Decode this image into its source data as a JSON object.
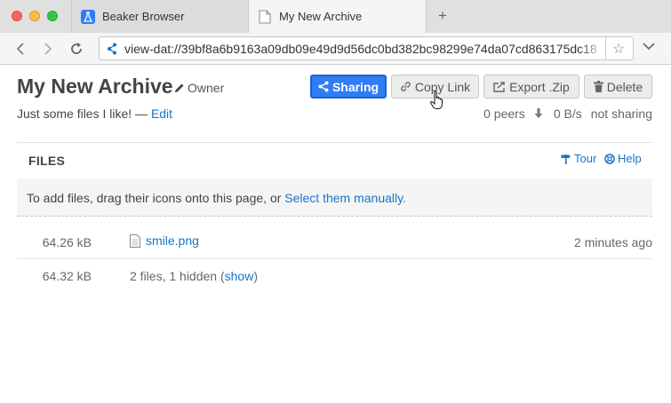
{
  "tabs": [
    {
      "title": "Beaker Browser",
      "icon": "beaker-icon"
    },
    {
      "title": "My New Archive",
      "icon": "page-icon"
    }
  ],
  "new_tab_label": "+",
  "url": "view-dat://39bf8a6b9163a09db09e49d9d56dc0bd382bc98299e74da07cd863175dc18",
  "archive": {
    "title": "My New Archive",
    "owner_label": "Owner",
    "description": "Just some files I like! — ",
    "edit_link": "Edit"
  },
  "buttons": {
    "sharing": "Sharing",
    "copy_link": "Copy Link",
    "export_zip": "Export .Zip",
    "delete": "Delete"
  },
  "stats": {
    "peers": "0 peers",
    "rate": "0 B/s",
    "status": "not sharing"
  },
  "files_section": {
    "title": "FILES",
    "tour": "Tour",
    "help": "Help",
    "drop_text": "To add files, drag their icons onto this page, or ",
    "select_link": "Select them manually."
  },
  "files": [
    {
      "size": "64.26 kB",
      "name": "smile.png",
      "modified": "2 minutes ago"
    }
  ],
  "summary": {
    "size": "64.32 kB",
    "text": "2 files, 1 hidden (",
    "show_link": "show",
    "close": ")"
  },
  "colors": {
    "accent": "#2f7cf6",
    "link": "#1a73c8"
  }
}
